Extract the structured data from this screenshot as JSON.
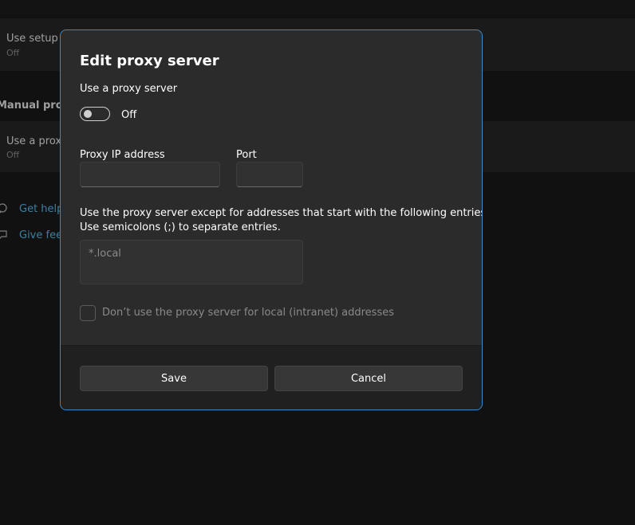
{
  "background": {
    "setup_script": {
      "title": "Use setup script",
      "status": "Off"
    },
    "manual_proxy_heading": "Manual proxy setup",
    "use_proxy": {
      "title": "Use a proxy server",
      "status": "Off"
    },
    "links": [
      {
        "label": "Get help",
        "icon": "help-icon"
      },
      {
        "label": "Give feedback",
        "icon": "feedback-icon"
      }
    ]
  },
  "dialog": {
    "title": "Edit proxy server",
    "use_proxy_label": "Use a proxy server",
    "toggle_state": "Off",
    "ip_label": "Proxy IP address",
    "ip_value": "",
    "port_label": "Port",
    "port_value": "",
    "exceptions_help_line1": "Use the proxy server except for addresses that start with the following entries.",
    "exceptions_help_line2": "Use semicolons (;) to separate entries.",
    "exceptions_placeholder": "*.local",
    "local_checkbox_label": "Don’t use the proxy server for local (intranet) addresses",
    "save_label": "Save",
    "cancel_label": "Cancel"
  },
  "colors": {
    "accent_border": "#3b88c8",
    "link": "#60cdff"
  }
}
